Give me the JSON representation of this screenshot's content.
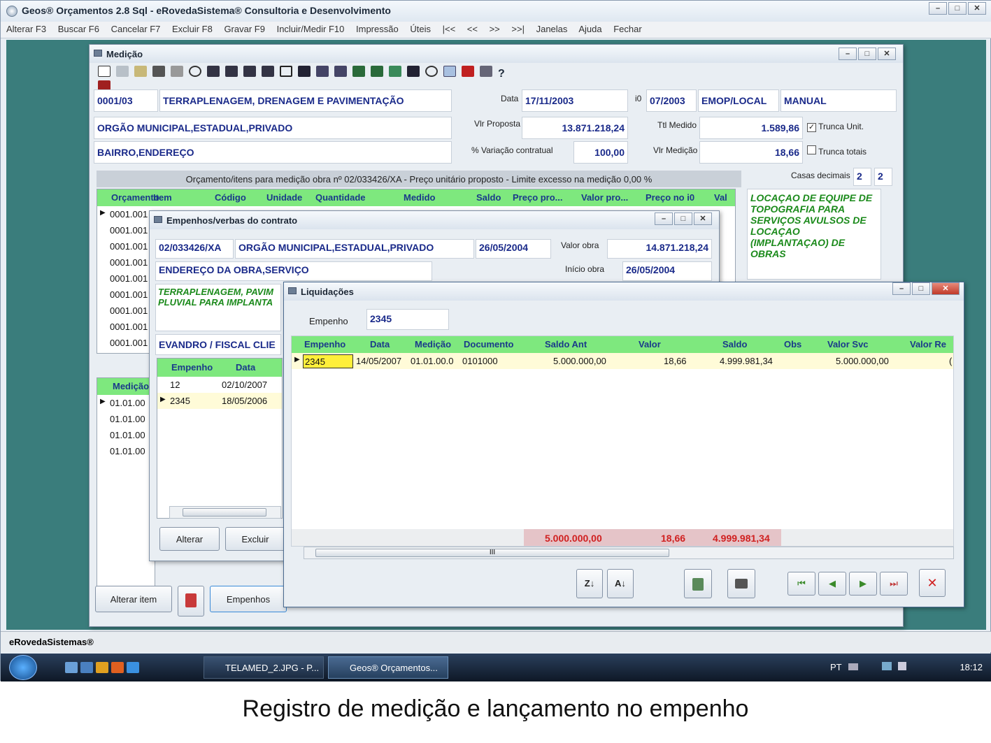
{
  "app": {
    "title": "Geos® Orçamentos 2.8 Sql - eRovedaSistema® Consultoria e Desenvolvimento",
    "status": "eRovedaSistemas®"
  },
  "menu": [
    "Alterar F3",
    "Buscar F6",
    "Cancelar F7",
    "Excluir F8",
    "Gravar F9",
    "Incluir/Medir F10",
    "Impressão",
    "Úteis",
    "|<<",
    "<<",
    ">>",
    ">>|",
    "Janelas",
    "Ajuda",
    "Fechar"
  ],
  "medicao": {
    "title": "Medição",
    "code": "0001/03",
    "obra": "TERRAPLENAGEM, DRENAGEM E PAVIMENTAÇÃO",
    "data_label": "Data",
    "data": "17/11/2003",
    "i0_label": "i0",
    "i0": "07/2003",
    "fonte": "EMOP/LOCAL",
    "modo": "MANUAL",
    "orgao": "ORGÃO MUNICIPAL,ESTADUAL,PRIVADO",
    "vlr_proposta_label": "Vlr Proposta",
    "vlr_proposta": "13.871.218,24",
    "ttl_medido_label": "Ttl Medido",
    "ttl_medido": "1.589,86",
    "trunca_unit": "Trunca Unit.",
    "bairro": "BAIRRO,ENDEREÇO",
    "variacao_label": "% Variação contratual",
    "variacao": "100,00",
    "vlr_medicao_label": "Vlr Medição",
    "vlr_medicao": "18,66",
    "trunca_totais": "Trunca totais",
    "casas_label": "Casas decimais",
    "casas1": "2",
    "casas2": "2",
    "grid_caption": "Orçamento/itens para medição obra nº 02/033426/XA - Preço unitário proposto - Limite excesso na medição 0,00 %",
    "columns": [
      "Orçamento",
      "Item",
      "Código",
      "Unidade",
      "Quantidade",
      "Medido",
      "Saldo",
      "Preço pro...",
      "Valor pro...",
      "Preço no i0",
      "Val"
    ],
    "rows": [
      "0001.001",
      "0001.001",
      "0001.001",
      "0001.001",
      "0001.001",
      "0001.001",
      "0001.001",
      "0001.001",
      "0001.001"
    ],
    "descricao": "LOCAÇAO DE EQUIPE DE TOPOGRAFIA PARA SERVIÇOS AVULSOS DE LOCAÇAO (IMPLANTAÇAO) DE OBRAS",
    "medicao_col": "Medição",
    "medicao_rows": [
      "01.01.00",
      "01.01.00",
      "01.01.00",
      "01.01.00"
    ],
    "btn_alterar": "Alterar item",
    "btn_empenhos": "Empenhos"
  },
  "empenhos": {
    "title": "Empenhos/verbas do contrato",
    "contrato": "02/033426/XA",
    "orgao": "ORGÃO MUNICIPAL,ESTADUAL,PRIVADO",
    "data": "26/05/2004",
    "valor_obra_label": "Valor obra",
    "valor_obra": "14.871.218,24",
    "endereco": "ENDEREÇO DA OBRA,SERVIÇO",
    "inicio_label": "Início obra",
    "inicio": "26/05/2004",
    "descricao": "TERRAPLENAGEM, PAVIM PLUVIAL PARA IMPLANTA",
    "fiscal": "EVANDRO / FISCAL CLIE",
    "columns": [
      "Empenho",
      "Data"
    ],
    "rows": [
      {
        "empenho": "12",
        "data": "02/10/2007"
      },
      {
        "empenho": "2345",
        "data": "18/05/2006"
      }
    ],
    "btn_alterar": "Alterar",
    "btn_excluir": "Excluir"
  },
  "liquidacoes": {
    "title": "Liquidações",
    "empenho_label": "Empenho",
    "empenho": "2345",
    "columns": [
      "Empenho",
      "Data",
      "Medição",
      "Documento",
      "Saldo Ant",
      "Valor",
      "Saldo",
      "Obs",
      "Valor Svc",
      "Valor Re"
    ],
    "rows": [
      {
        "empenho": "2345",
        "data": "14/05/2007",
        "medicao": "01.01.00.0",
        "documento": "0101000",
        "saldo_ant": "5.000.000,00",
        "valor": "18,66",
        "saldo": "4.999.981,34",
        "obs": "",
        "valor_svc": "5.000.000,00",
        "valor_re": "("
      }
    ],
    "totals": {
      "saldo_ant": "5.000.000,00",
      "valor": "18,66",
      "saldo": "4.999.981,34"
    },
    "scroll_mark": "III"
  },
  "taskbar": {
    "task1": "TELAMED_2.JPG - P...",
    "task2": "Geos® Orçamentos...",
    "lang": "PT",
    "clock": "18:12"
  },
  "caption": "Registro de medição e lançamento no empenho",
  "colors": {
    "grid_header": "#7ee87e",
    "desktop": "#3a7d7c",
    "field_text": "#1a2a8a",
    "total_text": "#d02020"
  }
}
